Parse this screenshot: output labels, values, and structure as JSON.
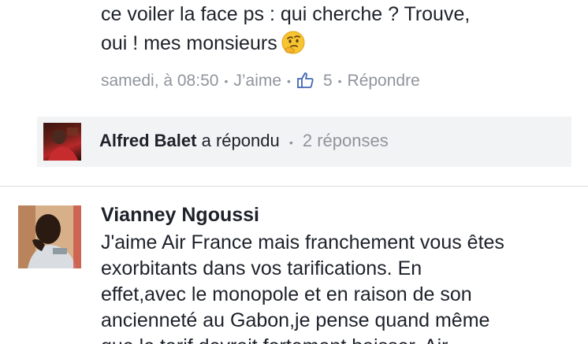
{
  "comment1": {
    "text_lines": [
      "ce voiler la face ps : qui cherche ? Trouve,",
      "oui ! mes monsieurs"
    ],
    "emoji": "thinking-face",
    "meta": {
      "time": "samedi, à 08:50",
      "like_label": "J’aime",
      "like_count": "5",
      "reply_label": "Répondre"
    }
  },
  "replies": {
    "author": "Alfred Balet",
    "action": "a répondu",
    "count_text": "2 réponses"
  },
  "comment2": {
    "author": "Vianney Ngoussi",
    "text_lines": [
      "J'aime Air France mais franchement vous êtes",
      "exorbitants dans vos tarifications. En",
      "effet,avec le monopole et en raison de son",
      "ancienneté au Gabon,je pense quand même",
      "que le tarif devrait fortement baisser. Air"
    ]
  },
  "colors": {
    "text": "#1d2129",
    "muted": "#90949c",
    "link_blue": "#4267b2",
    "reply_bg": "#f2f3f5",
    "divider": "#dadde1"
  }
}
